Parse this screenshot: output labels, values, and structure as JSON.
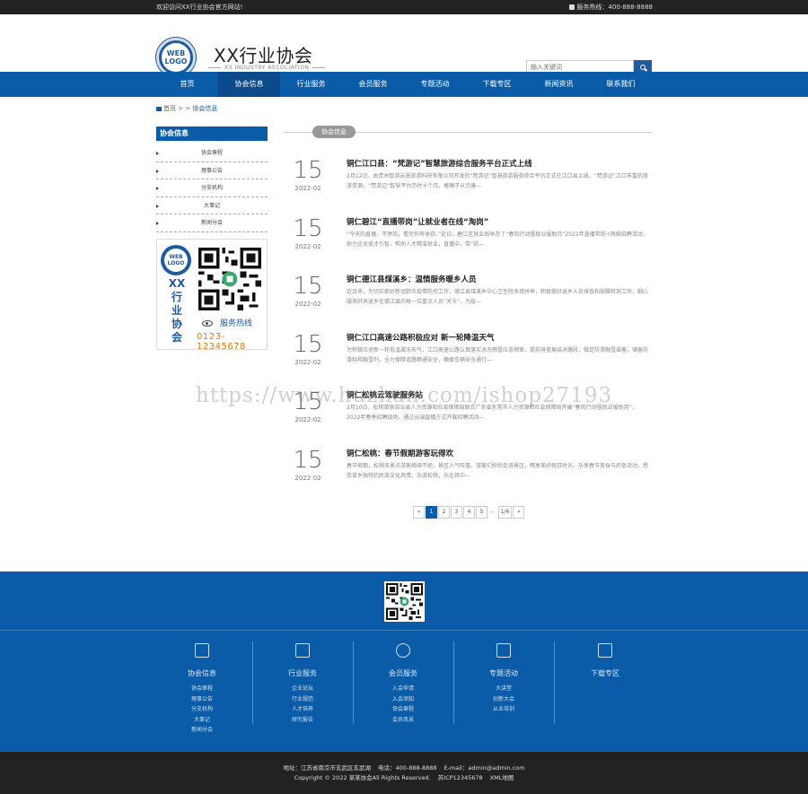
{
  "topbar": {
    "welcome": "欢迎访问XX行业协会官方网站!",
    "hotline_label": "服务热线：",
    "hotline_number": "400-888-8888"
  },
  "header": {
    "logo_line1": "WEB",
    "logo_line2": "LOGO",
    "title": "XX行业协会",
    "subtitle": "XX INDUSTRY ASSOCIATION",
    "search_placeholder": "输入关键词"
  },
  "nav": {
    "items": [
      {
        "label": "首页"
      },
      {
        "label": "协会信息",
        "active": true
      },
      {
        "label": "行业服务"
      },
      {
        "label": "会员服务"
      },
      {
        "label": "专题活动"
      },
      {
        "label": "下载专区"
      },
      {
        "label": "新闻资讯"
      },
      {
        "label": "联系我们"
      }
    ]
  },
  "breadcrumb": {
    "home": "首页",
    "sep": " > > ",
    "current": "协会信息"
  },
  "sidebar": {
    "heading": "协会信息",
    "items": [
      {
        "label": "协会章程"
      },
      {
        "label": "理事公告"
      },
      {
        "label": "分支机构"
      },
      {
        "label": "大事记"
      },
      {
        "label": "新闻分会"
      }
    ],
    "card": {
      "logo_line1": "WEB",
      "logo_line2": "LOGO",
      "name_chars": [
        "XX",
        "行",
        "业",
        "协",
        "会"
      ],
      "hotline_label": "服务热线",
      "phone": "0123-12345678"
    }
  },
  "section": {
    "tag": "协会信息"
  },
  "news": [
    {
      "day": "15",
      "ym": "2022-02",
      "title": "铜仁江口县：“梵游记”智慧旅游综合服务平台正式上线",
      "summary": "2月12日，由贵州智游云慧旅游科技有限公司开发的“梵游记”智慧旅游服务综合平台正式在江口县上线。“梵游记”江口丰富的旅游资源，“梵游记”智慧平台历时十个月，着眼于从完善—"
    },
    {
      "day": "15",
      "ym": "2022-02",
      "title": "铜仁碧江“直播带岗”让就业者在线“淘岗”",
      "summary": "“今天的直播，不停岗，看完你有收获。”近日，碧江区就业局举办了“春风行动暨就业援助月”2022年直播带岗+网络招聘活动，助力企业揽才引智，帮助人才精准就业，直播中，带“岗—"
    },
    {
      "day": "15",
      "ym": "2022-02",
      "title": "铜仁德江县煤溪乡：温情服务暖乡人员",
      "summary": "近日来，为切实抓好新冠肺炎疫情防控工作，德江县煤溪乡中心卫生院多措并举，积极做好返乡人员排查和核酸检测工作，细心服务好来返乡在德江县的每一位重点人员“关卡”，为疫—"
    },
    {
      "day": "15",
      "ym": "2022-02",
      "title": "铜仁江口高速公路积极应对 新一轮降温天气",
      "summary": "为积极应对新一轮低温凝冻天气，江口高速公路认真落实冰冻雨雪应急预案，提前排查易结冰路段，做足防滑融雪准备，储备防滑料和融雪剂，全力保障道路畅通安全，确保车辆安全通行—"
    },
    {
      "day": "15",
      "ym": "2022-02",
      "title": "铜仁松桃云驾驶服务站",
      "summary": "2月10日，松桃苗族自治县人力资源和社会保障局联合广东省东莞市人力资源和社会保障局开展“春风行动暨就业援助月”，2022年春季招聘现场，通过云端直播方式开展招聘活动—"
    },
    {
      "day": "15",
      "ym": "2022-02",
      "title": "铜仁松桃：春节假期游客玩得欢",
      "summary": "春节假期，松桃各景点游客络绎不绝，景区人气旺盛，游客们纷纷走进景区，畅享美好假日时光，乐享春节美食与民俗活动，感受苗乡独特的民族文化风情，乐游松桃，乐在其中—"
    }
  ],
  "pager": {
    "prev": "«",
    "pages": [
      "1",
      "2",
      "3",
      "4",
      "5"
    ],
    "ellipsis": "...",
    "total": "1/6",
    "next": "»"
  },
  "watermark": "https://www.huzhan.com/ishop27193",
  "footer": {
    "columns": [
      {
        "title": "协会信息",
        "icon": "calendar-icon",
        "links": [
          "协会章程",
          "理事公告",
          "分支机构",
          "大事记",
          "新闻分会"
        ]
      },
      {
        "title": "行业服务",
        "icon": "box-icon",
        "links": [
          "企业论坛",
          "行业规范",
          "人才培养",
          "研究报告"
        ]
      },
      {
        "title": "会员服务",
        "icon": "users-icon",
        "links": [
          "入会申请",
          "入会须知",
          "协会章程",
          "会员风采"
        ]
      },
      {
        "title": "专题活动",
        "icon": "printer-icon",
        "links": [
          "大讲堂",
          "创新大会",
          "从业培训"
        ]
      },
      {
        "title": "下载专区",
        "icon": "chat-icon",
        "links": []
      }
    ],
    "address_label": "地址：",
    "address": "江苏省南京市玄武区玄武湖",
    "phone_label": "电话：",
    "phone": "400-888-8888",
    "email_label": "E-mail：",
    "email": "admin@admin.com",
    "copyright": "Copyright © 2022 某某协会All Rights Reserved.",
    "icp": "苏ICP12345678",
    "sitemap": "XML地图"
  }
}
